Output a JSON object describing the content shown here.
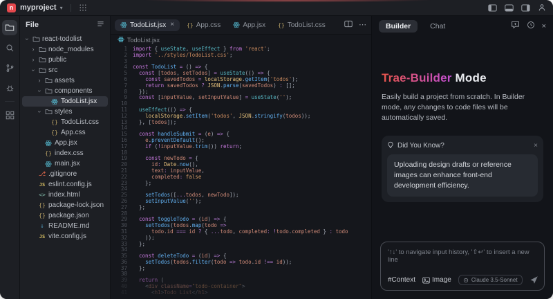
{
  "titlebar": {
    "project": "myproject"
  },
  "activity_bar": {
    "items": [
      {
        "name": "explorer",
        "icon": "folder-icon",
        "active": true
      },
      {
        "name": "search",
        "icon": "search-icon",
        "active": false
      },
      {
        "name": "source-control",
        "icon": "branch-icon",
        "active": false
      },
      {
        "name": "debug",
        "icon": "bug-icon",
        "active": false
      },
      {
        "name": "extensions",
        "icon": "extensions-icon",
        "active": false,
        "divider_before": true
      }
    ]
  },
  "explorer": {
    "header": "File",
    "tree": [
      {
        "label": "react-todolist",
        "icon": "folder",
        "chevron": "down",
        "level": 0
      },
      {
        "label": "node_modules",
        "icon": "folder",
        "chevron": "right",
        "level": 1
      },
      {
        "label": "public",
        "icon": "folder",
        "chevron": "right",
        "level": 1
      },
      {
        "label": "src",
        "icon": "folder",
        "chevron": "down",
        "level": 1
      },
      {
        "label": "assets",
        "icon": "folder",
        "chevron": "right",
        "level": 2
      },
      {
        "label": "components",
        "icon": "folder",
        "chevron": "down",
        "level": 2
      },
      {
        "label": "TodoList.jsx",
        "icon": "react",
        "level": 3,
        "selected": true
      },
      {
        "label": "styles",
        "icon": "folder",
        "chevron": "down",
        "level": 2
      },
      {
        "label": "TodoList.css",
        "icon": "braces",
        "level": 3
      },
      {
        "label": "App.css",
        "icon": "braces",
        "level": 3
      },
      {
        "label": "App.jsx",
        "icon": "react",
        "level": 2
      },
      {
        "label": "index.css",
        "icon": "braces",
        "level": 2
      },
      {
        "label": "main.jsx",
        "icon": "react",
        "level": 2
      },
      {
        "label": ".gitignore",
        "icon": "git",
        "level": 1
      },
      {
        "label": "eslint.config.js",
        "icon": "js",
        "level": 1
      },
      {
        "label": "index.html",
        "icon": "html",
        "level": 1
      },
      {
        "label": "package-lock.json",
        "icon": "braces",
        "level": 1
      },
      {
        "label": "package.json",
        "icon": "braces",
        "level": 1
      },
      {
        "label": "README.md",
        "icon": "readme",
        "level": 1
      },
      {
        "label": "vite.config.js",
        "icon": "js",
        "level": 1
      }
    ]
  },
  "editor": {
    "tabs": [
      {
        "label": "TodoList.jsx",
        "icon": "react",
        "active": true,
        "closable": true
      },
      {
        "label": "App.css",
        "icon": "braces",
        "active": false
      },
      {
        "label": "App.jsx",
        "icon": "react",
        "active": false
      },
      {
        "label": "TodoList.css",
        "icon": "braces",
        "active": false
      }
    ],
    "breadcrumb": "TodoList.jsx",
    "code_lines": [
      "import { useState, useEffect } from 'react';",
      "import '../styles/TodoList.css';",
      "",
      "const TodoList = () => {",
      "  const [todos, setTodos] = useState(() => {",
      "    const savedTodos = localStorage.getItem('todos');",
      "    return savedTodos ? JSON.parse(savedTodos) : [];",
      "  });",
      "  const [inputValue, setInputValue] = useState('');",
      "",
      "  useEffect(() => {",
      "    localStorage.setItem('todos', JSON.stringify(todos));",
      "  }, [todos]);",
      "",
      "  const handleSubmit = (e) => {",
      "    e.preventDefault();",
      "    if (!inputValue.trim()) return;",
      "",
      "    const newTodo = {",
      "      id: Date.now(),",
      "      text: inputValue,",
      "      completed: false",
      "    };",
      "",
      "    setTodos([...todos, newTodo]);",
      "    setInputValue('');",
      "  };",
      "",
      "  const toggleTodo = (id) => {",
      "    setTodos(todos.map(todo =>",
      "      todo.id === id ? { ...todo, completed: !todo.completed } : todo",
      "    ));",
      "  };",
      "",
      "  const deleteTodo = (id) => {",
      "    setTodos(todos.filter(todo => todo.id !== id));",
      "  };",
      "",
      "  return (",
      "    <div className=\"todo-container\">",
      "      <h1>Todo List</h1>"
    ]
  },
  "builder": {
    "tab_builder": "Builder",
    "tab_chat": "Chat",
    "title_gradient": "Trae-Builder",
    "title_rest": "Mode",
    "description": "Easily build a project from scratch. In Builder mode, any changes to code files will be automatically saved.",
    "tip": {
      "title": "Did You Know?",
      "body": "Uploading design drafts or reference images can enhance front-end development efficiency."
    },
    "input": {
      "placeholder": "'↑↓' to navigate input history, '⇧↵' to insert a new line",
      "context_label": "#Context",
      "image_label": "Image",
      "model": "Claude 3.5-Sonnet"
    }
  },
  "colors": {
    "accent_red": "#e5484d",
    "gradient_from": "#e8554a",
    "gradient_to": "#c24fd4",
    "syntax": {
      "keyword": "#c678dd",
      "string": "#c98a5e",
      "hook": "#56b6c2",
      "builtin": "#e5c07b",
      "bool": "#d19a66",
      "func": "#61afef",
      "variable": "#cf8a77",
      "operator": "#b479d1",
      "default": "#a7adb8"
    }
  }
}
